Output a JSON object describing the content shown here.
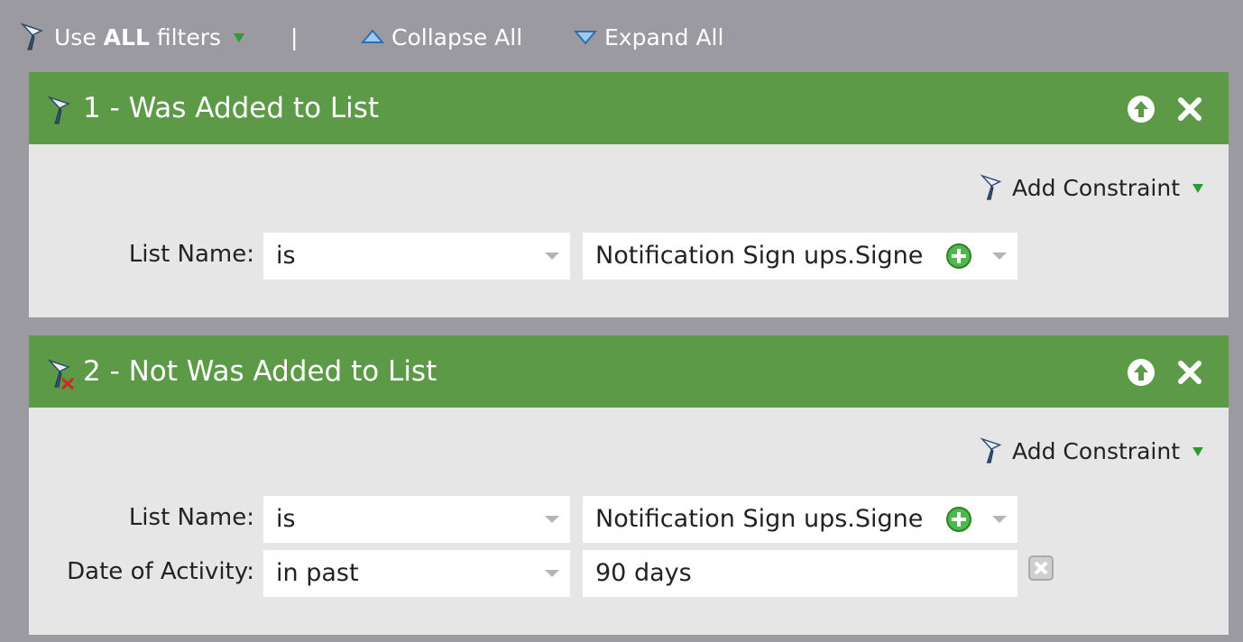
{
  "toolbar": {
    "use_prefix": "Use",
    "use_bold": "ALL",
    "use_suffix": "filters",
    "separator": "|",
    "collapse_label": "Collapse All",
    "expand_label": "Expand All"
  },
  "filters": [
    {
      "title": "1 - Was Added to List",
      "add_constraint": "Add Constraint",
      "rows": [
        {
          "label": "List Name:",
          "operator": "is",
          "value": "Notification Sign ups.Signed U"
        }
      ]
    },
    {
      "title": "2 - Not Was Added to List",
      "add_constraint": "Add Constraint",
      "rows": [
        {
          "label": "List Name:",
          "operator": "is",
          "value": "Notification Sign ups.Signed U"
        },
        {
          "label": "Date of Activity:",
          "operator": "in past",
          "value": "90 days"
        }
      ]
    }
  ],
  "colors": {
    "background": "#9b9aa0",
    "header_green": "#5c9a47",
    "panel": "#e6e6e6",
    "accent_green": "#2e9b2e"
  },
  "icons": [
    "funnel-icon",
    "funnel-negated-icon",
    "dropdown-triangle-icon",
    "collapse-triangle-icon",
    "expand-triangle-icon",
    "move-up-icon",
    "close-icon",
    "add-circle-icon",
    "remove-constraint-icon"
  ]
}
